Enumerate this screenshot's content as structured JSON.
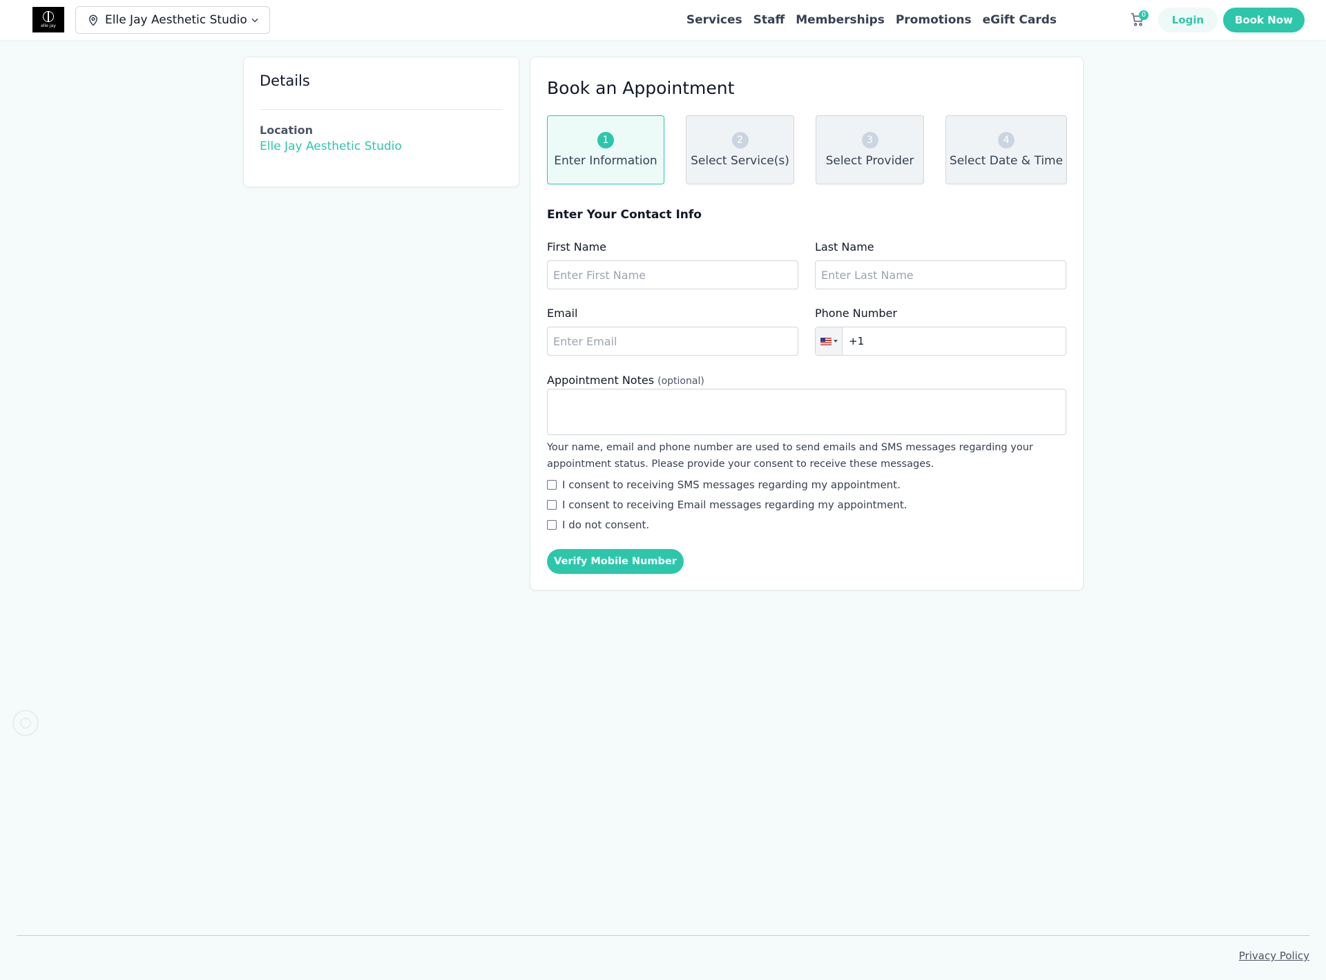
{
  "header": {
    "logo_text": "elle jay",
    "location_select": {
      "value": "Elle Jay Aesthetic Studio",
      "icon": "map-pin-icon"
    },
    "nav": [
      "Services",
      "Staff",
      "Memberships",
      "Promotions",
      "eGift Cards"
    ],
    "cart_count": "0",
    "login_label": "Login",
    "book_now_label": "Book Now"
  },
  "details": {
    "title": "Details",
    "location_label": "Location",
    "location_value": "Elle Jay Aesthetic Studio"
  },
  "booking": {
    "title": "Book an Appointment",
    "steps": [
      {
        "num": "1",
        "label": "Enter Information",
        "active": true
      },
      {
        "num": "2",
        "label": "Select Service(s)",
        "active": false
      },
      {
        "num": "3",
        "label": "Select Provider",
        "active": false
      },
      {
        "num": "4",
        "label": "Select Date & Time",
        "active": false
      }
    ],
    "section_title": "Enter Your Contact Info",
    "first_name": {
      "label": "First Name",
      "placeholder": "Enter First Name",
      "value": ""
    },
    "last_name": {
      "label": "Last Name",
      "placeholder": "Enter Last Name",
      "value": ""
    },
    "email": {
      "label": "Email",
      "placeholder": "Enter Email",
      "value": ""
    },
    "phone": {
      "label": "Phone Number",
      "country": "US",
      "code": "+1"
    },
    "notes": {
      "label": "Appointment Notes",
      "optional": "(optional)"
    },
    "consent_text": "Your name, email and phone number are used to send emails and SMS messages regarding your appointment status. Please provide your consent to receive these messages.",
    "consents": [
      "I consent to receiving SMS messages regarding my appointment.",
      "I consent to receiving Email messages regarding my appointment.",
      "I do not consent."
    ],
    "verify_label": "Verify Mobile Number"
  },
  "footer": {
    "privacy_label": "Privacy Policy"
  },
  "colors": {
    "accent": "#2cc7aa",
    "background": "#f5fbfb"
  }
}
